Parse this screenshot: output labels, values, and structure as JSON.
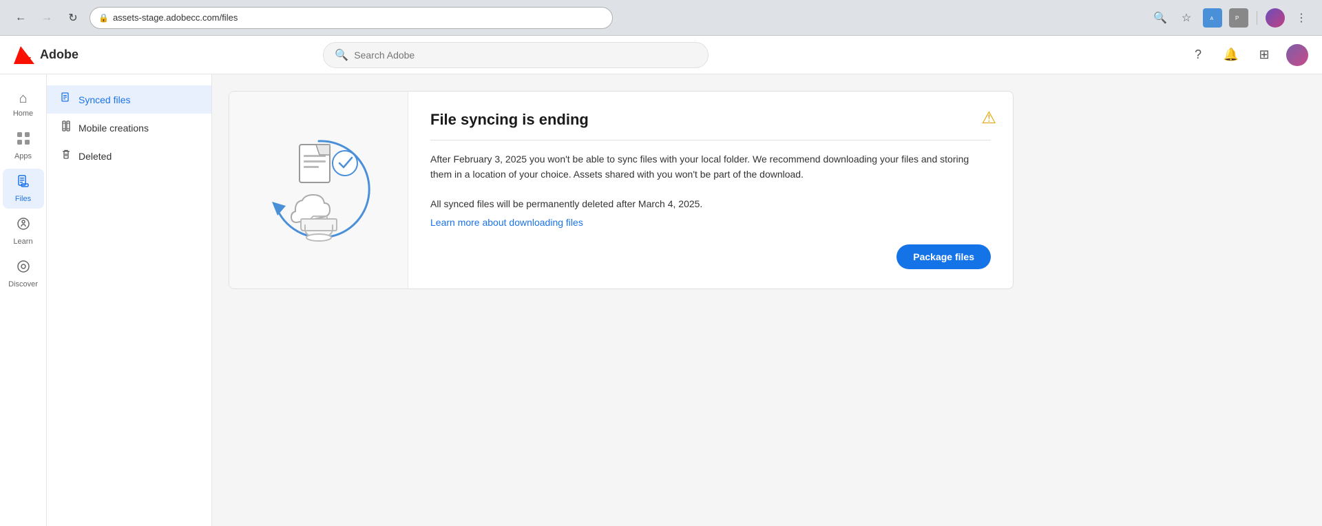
{
  "browser": {
    "url": "assets-stage.adobecc.com/files",
    "back_disabled": false,
    "forward_disabled": true
  },
  "header": {
    "logo_text": "Adobe",
    "search_placeholder": "Search Adobe"
  },
  "sidebar_nav": {
    "items": [
      {
        "id": "home",
        "label": "Home",
        "icon": "⌂"
      },
      {
        "id": "apps",
        "label": "Apps",
        "icon": "⊞"
      },
      {
        "id": "files",
        "label": "Files",
        "icon": "📄",
        "active": true
      },
      {
        "id": "learn",
        "label": "Learn",
        "icon": "💡"
      },
      {
        "id": "discover",
        "label": "Discover",
        "icon": "◎"
      }
    ]
  },
  "sidebar_secondary": {
    "items": [
      {
        "id": "synced-files",
        "label": "Synced files",
        "icon": "📋",
        "active": true
      },
      {
        "id": "mobile-creations",
        "label": "Mobile creations",
        "icon": "📱",
        "active": false
      },
      {
        "id": "deleted",
        "label": "Deleted",
        "icon": "🗑",
        "active": false
      }
    ]
  },
  "notice_card": {
    "title": "File syncing is ending",
    "divider": true,
    "body1": "After February 3, 2025 you won't be able to sync files with your local folder. We recommend downloading your files and storing them in a location of your choice. Assets shared with you won't be part of the download.",
    "body2": "All synced files will be permanently deleted after March 4, 2025.",
    "learn_link_text": "Learn more about downloading files",
    "package_button": "Package files",
    "warning_icon": "⚠️"
  }
}
